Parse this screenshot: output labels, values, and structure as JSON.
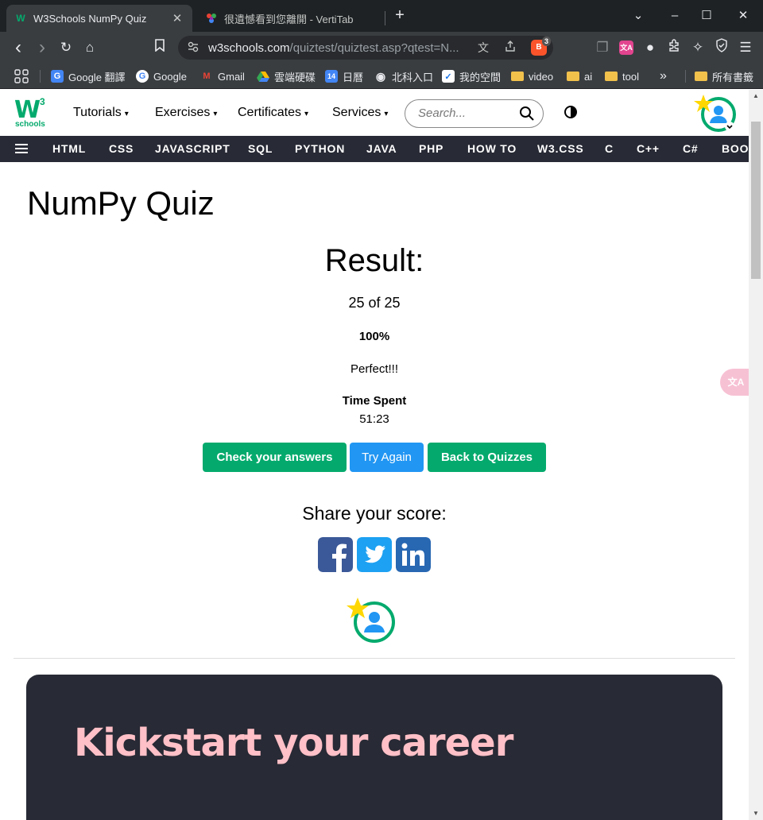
{
  "browser": {
    "tabs": [
      {
        "title": "W3Schools NumPy Quiz",
        "active": true
      },
      {
        "title": "很遺憾看到您離開 - VertiTab",
        "active": false
      }
    ],
    "new_tab": "+",
    "window_controls": {
      "dropdown": "⌄",
      "minimize": "–",
      "maximize": "☐",
      "close": "✕"
    },
    "nav": {
      "back": "‹",
      "forward": "›",
      "reload": "↻",
      "home": "⌂",
      "bookmark": "☐"
    },
    "address": {
      "host": "w3schools.com",
      "path": "/quiztest/quiztest.asp?qtest=N..."
    },
    "brave_count": "3",
    "bookmarks": [
      {
        "label": "Google 翻譯"
      },
      {
        "label": "Google"
      },
      {
        "label": "Gmail"
      },
      {
        "label": "雲端硬碟"
      },
      {
        "label": "日曆"
      },
      {
        "label": "北科入口"
      },
      {
        "label": "我的空間"
      },
      {
        "label": "video"
      },
      {
        "label": "ai"
      },
      {
        "label": "tool"
      },
      {
        "label": "所有書籤"
      }
    ],
    "bookmarks_overflow": "»",
    "calendar_day": "14"
  },
  "w3": {
    "logo": {
      "w": "W",
      "three": "3",
      "schools": "schools"
    },
    "menu": [
      "Tutorials",
      "Exercises",
      "Certificates",
      "Services"
    ],
    "menu_caret": "▾",
    "search_placeholder": "Search...",
    "topnav": [
      "HTML",
      "CSS",
      "JAVASCRIPT",
      "SQL",
      "PYTHON",
      "JAVA",
      "PHP",
      "HOW TO",
      "W3.CSS",
      "C",
      "C++",
      "C#",
      "BOOTSTRAP"
    ]
  },
  "quiz": {
    "title": "NumPy Quiz",
    "result_heading": "Result:",
    "score": "25 of 25",
    "percent": "100%",
    "message": "Perfect!!!",
    "time_label": "Time Spent",
    "time_value": "51:23",
    "buttons": {
      "check": "Check your answers",
      "try_again": "Try Again",
      "back": "Back to Quizzes"
    },
    "share_heading": "Share your score:"
  },
  "career": {
    "heading": "Kickstart your career"
  },
  "colors": {
    "green": "#04aa6d",
    "blue": "#2196f3",
    "dark": "#282a35",
    "pink": "#ffc0c7",
    "facebook": "#3b5998",
    "twitter": "#1da1f2",
    "linkedin": "#2867b2"
  }
}
